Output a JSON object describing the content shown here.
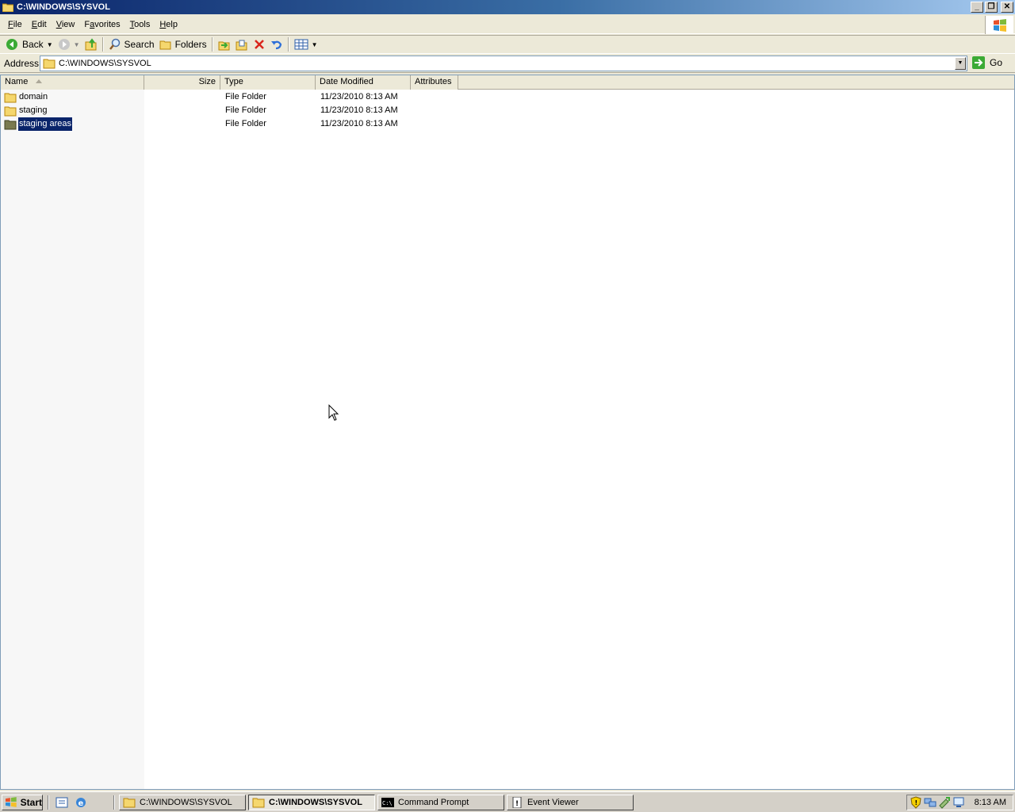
{
  "window": {
    "title": "C:\\WINDOWS\\SYSVOL",
    "controls": {
      "minimize": "_",
      "restore": "❐",
      "close": "✕"
    }
  },
  "menu": [
    {
      "label": "File",
      "accel": "F",
      "rest": "ile"
    },
    {
      "label": "Edit",
      "accel": "E",
      "rest": "dit"
    },
    {
      "label": "View",
      "accel": "V",
      "rest": "iew"
    },
    {
      "label": "Favorites",
      "accel": "a",
      "pre": "F",
      "rest": "vorites"
    },
    {
      "label": "Tools",
      "accel": "T",
      "rest": "ools"
    },
    {
      "label": "Help",
      "accel": "H",
      "rest": "elp"
    }
  ],
  "toolbar": {
    "back_label": "Back",
    "search_label": "Search",
    "folders_label": "Folders"
  },
  "address": {
    "label": "Address",
    "value": "C:\\WINDOWS\\SYSVOL",
    "go_label": "Go"
  },
  "columns": {
    "name": "Name",
    "size": "Size",
    "type": "Type",
    "date": "Date Modified",
    "attributes": "Attributes"
  },
  "files": [
    {
      "name": "domain",
      "size": "",
      "type": "File Folder",
      "date": "11/23/2010 8:13 AM",
      "attributes": "",
      "selected": false
    },
    {
      "name": "staging",
      "size": "",
      "type": "File Folder",
      "date": "11/23/2010 8:13 AM",
      "attributes": "",
      "selected": false
    },
    {
      "name": "staging areas",
      "size": "",
      "type": "File Folder",
      "date": "11/23/2010 8:13 AM",
      "attributes": "",
      "selected": true
    }
  ],
  "taskbar": {
    "start_label": "Start",
    "tasks": [
      {
        "label": "C:\\WINDOWS\\SYSVOL",
        "icon": "folder-icon",
        "active": false
      },
      {
        "label": "C:\\WINDOWS\\SYSVOL",
        "icon": "folder-icon",
        "active": true
      },
      {
        "label": "Command Prompt",
        "icon": "command-prompt-icon",
        "active": false
      },
      {
        "label": "Event Viewer",
        "icon": "event-viewer-icon",
        "active": false
      }
    ],
    "clock": "8:13 AM"
  }
}
